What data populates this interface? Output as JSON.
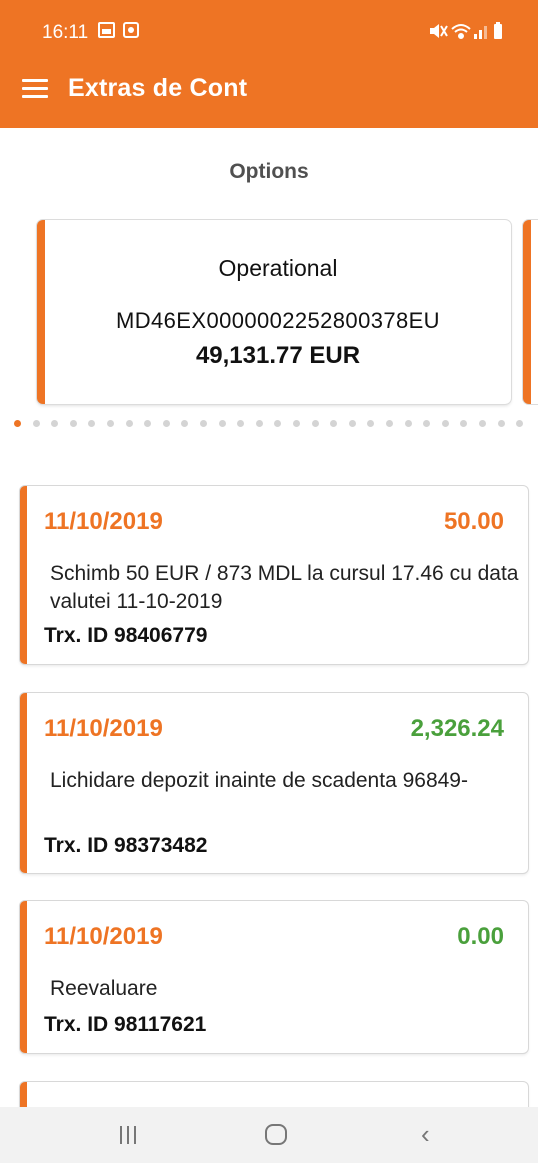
{
  "status_bar": {
    "time": "16:11"
  },
  "app_bar": {
    "title": "Extras de Cont"
  },
  "options": {
    "label": "Options"
  },
  "account": {
    "name": "Operational",
    "iban": "MD46EX0000002252800378EU",
    "balance": "49,131.77 EUR"
  },
  "pager": {
    "total_dots": 28,
    "active_index": 0
  },
  "transactions": [
    {
      "date": "11/10/2019",
      "amount": "50.00",
      "amount_color": "#ee7424",
      "description": "Schimb 50 EUR / 873 MDL la cursul 17.46 cu data valutei 11-10-2019",
      "trx_id": "Trx. ID 98406779"
    },
    {
      "date": "11/10/2019",
      "amount": "2,326.24",
      "amount_color": "#4aa03c",
      "description": "Lichidare depozit inainte de scadenta 96849-",
      "trx_id": "Trx. ID 98373482"
    },
    {
      "date": "11/10/2019",
      "amount": "0.00",
      "amount_color": "#4aa03c",
      "description": "Reevaluare",
      "trx_id": "Trx. ID 98117621"
    }
  ],
  "colors": {
    "accent": "#ee7424",
    "credit": "#4aa03c"
  }
}
